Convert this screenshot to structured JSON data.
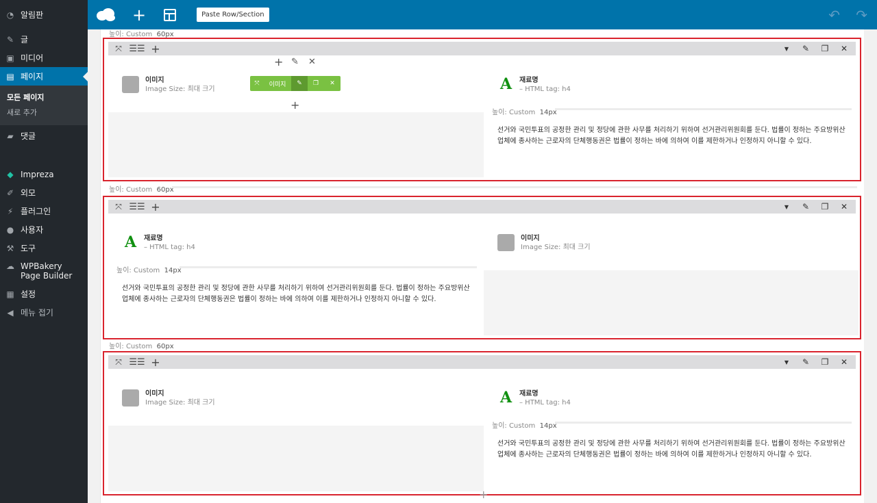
{
  "sidebar": {
    "items": [
      {
        "label": "알림판",
        "icon": "dashboard-icon"
      },
      {
        "label": "글",
        "icon": "pin-icon"
      },
      {
        "label": "미디어",
        "icon": "media-icon"
      },
      {
        "label": "페이지",
        "icon": "pages-icon"
      },
      {
        "label": "댓글",
        "icon": "comments-icon"
      },
      {
        "label": "Impreza",
        "icon": "diamond-icon"
      },
      {
        "label": "외모",
        "icon": "brush-icon"
      },
      {
        "label": "플러그인",
        "icon": "plugin-icon"
      },
      {
        "label": "사용자",
        "icon": "user-icon"
      },
      {
        "label": "도구",
        "icon": "wrench-icon"
      },
      {
        "label": "WPBakery Page Builder",
        "icon": "cloud-icon"
      },
      {
        "label": "설정",
        "icon": "settings-icon"
      },
      {
        "label": "메뉴 접기",
        "icon": "collapse-icon"
      }
    ],
    "submenu": [
      "모든 페이지",
      "새로 추가"
    ]
  },
  "topbar": {
    "paste_label": "Paste Row/Section"
  },
  "spacer": {
    "label": "높이: Custom",
    "row_value": "60px",
    "inner_value": "14px"
  },
  "image_el": {
    "title": "이미지",
    "sub": "Image Size: 최대 크기"
  },
  "heading_el": {
    "title": "재료명",
    "sub": "– HTML tag: h4"
  },
  "text_el": {
    "body": "선거와 국민투표의 공정한 관리 및 정당에 관한 사무를 처리하기 위하여 선거관리위원회를 둔다. 법률이 정하는 주요방위산업체에 종사하는 근로자의 단체행동권은 법률이 정하는 바에 의하여 이를 제한하거나 인정하지 아니할 수 있다."
  },
  "green_toolbar": {
    "label": "이미지"
  },
  "colors": {
    "sidebar_bg": "#23282d",
    "accent": "#0073aa",
    "row_border": "#d9232d",
    "element_toolbar": "#7ac142"
  }
}
